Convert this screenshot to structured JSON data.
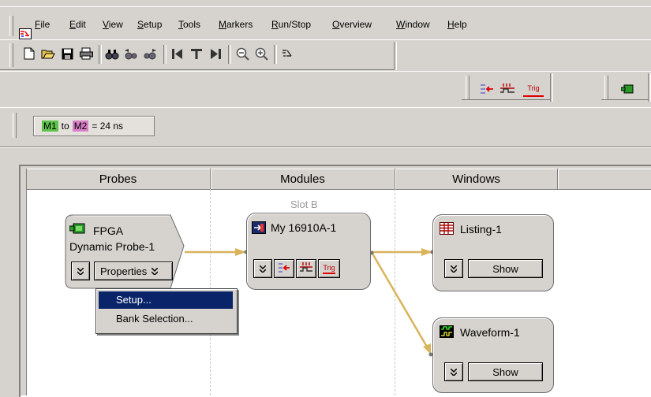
{
  "menu": {
    "file": "File",
    "edit": "Edit",
    "view": "View",
    "setup": "Setup",
    "tools": "Tools",
    "markers": "Markers",
    "runstop": "Run/Stop",
    "overview": "Overview",
    "window": "Window",
    "help": "Help"
  },
  "toolbar_icons": [
    "new-icon",
    "open-icon",
    "save-icon",
    "print-icon",
    "find-icon",
    "find-previous-icon",
    "find-next-icon",
    "go-to-start-icon",
    "go-to-trigger-icon",
    "go-to-end-icon",
    "zoom-out-icon",
    "zoom-in-icon",
    "overview-icon"
  ],
  "secondary_toolbar": {
    "trig_label": "Trig"
  },
  "markers": {
    "m1": "M1",
    "to": "to",
    "m2": "M2",
    "value": "= 24 ns"
  },
  "columns": {
    "probes": "Probes",
    "modules": "Modules",
    "windows": "Windows"
  },
  "probe_node": {
    "title_line1": "FPGA",
    "title_line2": "Dynamic Probe-1",
    "properties_label": "Properties"
  },
  "module_node": {
    "slot_label": "Slot B",
    "title": "My 16910A-1",
    "trig_label": "Trig"
  },
  "window_nodes": [
    {
      "title": "Listing-1",
      "show_label": "Show"
    },
    {
      "title": "Waveform-1",
      "show_label": "Show"
    }
  ],
  "properties_menu": {
    "items": [
      "Setup...",
      "Bank Selection..."
    ]
  },
  "colors": {
    "m1": "#5ec24a",
    "m2": "#d97fc8",
    "connector": "#d9b45a",
    "selection": "#0a246a"
  }
}
